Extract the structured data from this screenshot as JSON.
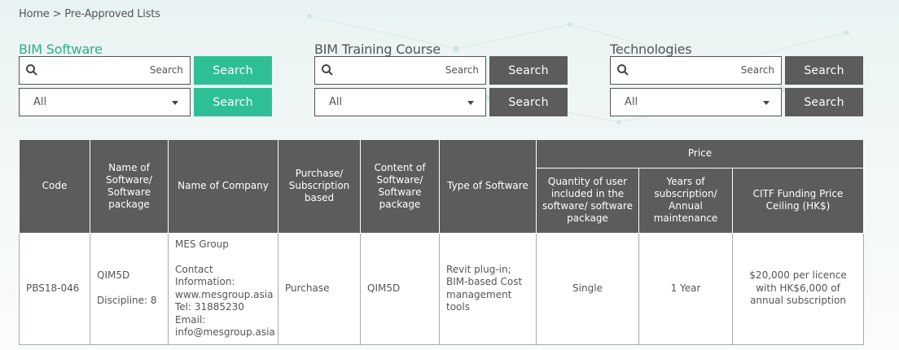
{
  "breadcrumb": {
    "home": "Home",
    "separator": ">",
    "current": "Pre-Approved Lists"
  },
  "filters": [
    {
      "title": "BIM Software",
      "active": true,
      "search_placeholder": "Search",
      "search_button": "Search",
      "select_value": "All",
      "select_button": "Search"
    },
    {
      "title": "BIM Training Course",
      "active": false,
      "search_placeholder": "Search",
      "search_button": "Search",
      "select_value": "All",
      "select_button": "Search"
    },
    {
      "title": "Technologies",
      "active": false,
      "search_placeholder": "Search",
      "search_button": "Search",
      "select_value": "All",
      "select_button": "Search"
    }
  ],
  "colors": {
    "accent": "#2fbf97",
    "accent_text": "#2ab08a",
    "button_dark": "#5c5c5c",
    "header_bg": "#5c5c5c"
  },
  "icons": {
    "search": "search-icon",
    "dropdown": "chevron-down-icon"
  },
  "table": {
    "headers": {
      "code": "Code",
      "name": "Name of Software/ Software package",
      "company": "Name of Company",
      "purchase": "Purchase/ Subscription based",
      "content": "Content of Software/ Software package",
      "type": "Type of Software",
      "price": "Price",
      "quantity": "Quantity of user included in the software/ software package",
      "years": "Years of subscription/ Annual maintenance",
      "ceiling": "CITF Funding Price Ceiling (HK$)"
    },
    "rows": [
      {
        "code": "PBS18-046",
        "name": "QIM5D",
        "discipline": "Discipline: 8",
        "company": "MES Group",
        "contact_label": "Contact Information:",
        "website": "www.mesgroup.asia",
        "tel": "Tel: 31885230",
        "email_label": "Email:",
        "email": "info@mesgroup.asia",
        "purchase": "Purchase",
        "content": "QIM5D",
        "type": "Revit plug-in; BIM-based Cost management tools",
        "quantity": "Single",
        "years": "1 Year",
        "ceiling": "$20,000 per licence with HK$6,000 of annual subscription"
      }
    ]
  }
}
